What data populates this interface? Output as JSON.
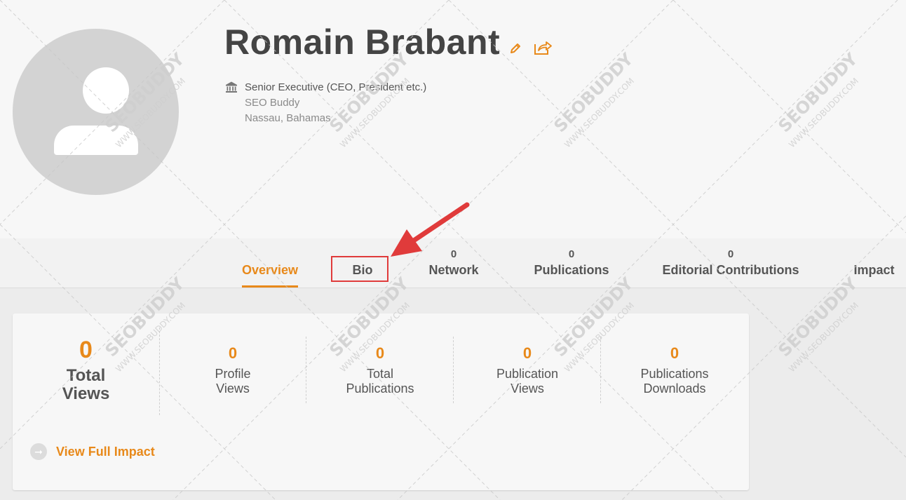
{
  "profile": {
    "name": "Romain Brabant",
    "title": "Senior Executive (CEO, President etc.)",
    "company": "SEO Buddy",
    "location": "Nassau, Bahamas"
  },
  "icons": {
    "edit": "pencil-icon",
    "share": "share-icon",
    "institution": "bank-icon",
    "avatar": "user-placeholder-icon"
  },
  "tabs": [
    {
      "label": "Overview",
      "count": "",
      "active": true
    },
    {
      "label": "Bio",
      "count": "",
      "active": false
    },
    {
      "label": "Network",
      "count": "0",
      "active": false
    },
    {
      "label": "Publications",
      "count": "0",
      "active": false
    },
    {
      "label": "Editorial Contributions",
      "count": "0",
      "active": false
    },
    {
      "label": "Impact",
      "count": "",
      "active": false
    }
  ],
  "stats": {
    "total_views": {
      "value": "0",
      "label_line1": "Total",
      "label_line2": "Views"
    },
    "items": [
      {
        "value": "0",
        "line1": "Profile",
        "line2": "Views"
      },
      {
        "value": "0",
        "line1": "Total",
        "line2": "Publications"
      },
      {
        "value": "0",
        "line1": "Publication",
        "line2": "Views"
      },
      {
        "value": "0",
        "line1": "Publications",
        "line2": "Downloads"
      }
    ]
  },
  "view_full_impact": "View Full Impact",
  "watermark": {
    "brand": "SEOBUDDY",
    "url": "WWW.SEOBUDDY.COM"
  },
  "colors": {
    "accent": "#e8891a",
    "annotation": "#e03b3b",
    "avatar_bg": "#d3d3d3",
    "text": "#555555"
  }
}
